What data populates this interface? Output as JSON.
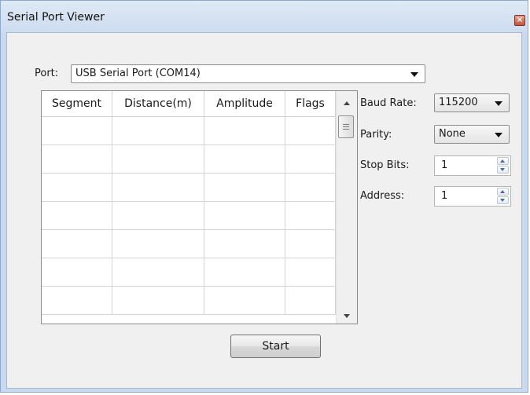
{
  "window": {
    "title": "Serial Port Viewer",
    "close_glyph": "×"
  },
  "port": {
    "label": "Port:",
    "value": "USB Serial Port (COM14)"
  },
  "table": {
    "columns": [
      "Segment",
      "Distance(m)",
      "Amplitude",
      "Flags"
    ],
    "rows": [
      [
        "",
        "",
        "",
        ""
      ],
      [
        "",
        "",
        "",
        ""
      ],
      [
        "",
        "",
        "",
        ""
      ],
      [
        "",
        "",
        "",
        ""
      ],
      [
        "",
        "",
        "",
        ""
      ],
      [
        "",
        "",
        "",
        ""
      ],
      [
        "",
        "",
        "",
        ""
      ]
    ]
  },
  "settings": {
    "baud_rate": {
      "label": "Baud Rate:",
      "value": "115200"
    },
    "parity": {
      "label": "Parity:",
      "value": "None"
    },
    "stop_bits": {
      "label": "Stop Bits:",
      "value": "1"
    },
    "address": {
      "label": "Address:",
      "value": "1"
    }
  },
  "actions": {
    "start_label": "Start"
  }
}
